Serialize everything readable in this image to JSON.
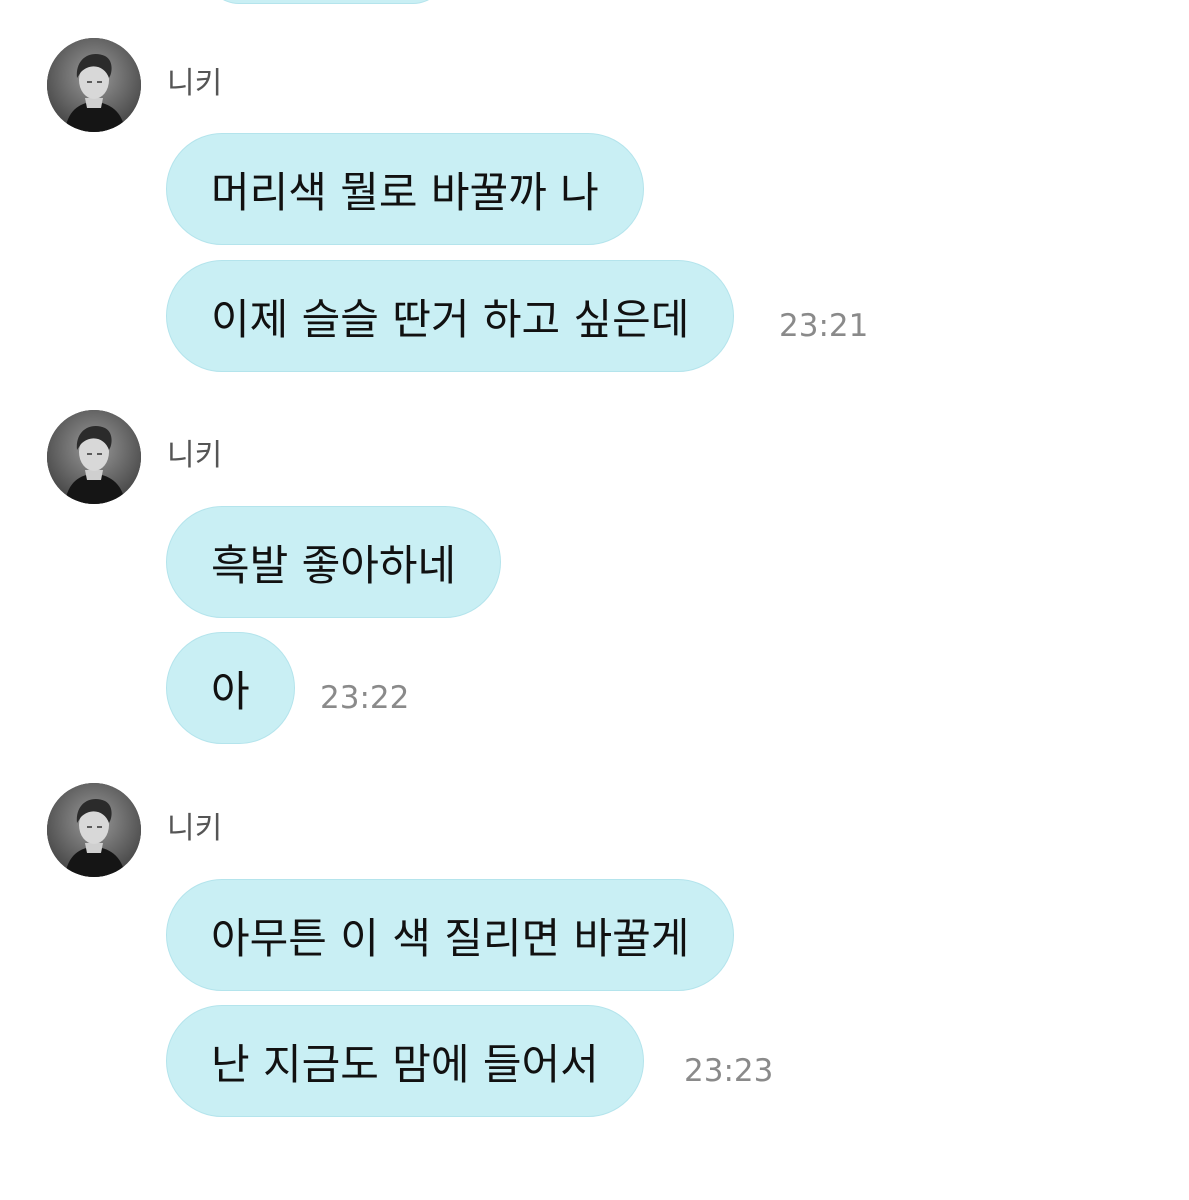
{
  "colors": {
    "bubble": "#c9eff4",
    "bubble_border": "#b4e4ec",
    "sender_text": "#555555",
    "time_text": "#8a8a8a"
  },
  "groups": [
    {
      "sender": "니키",
      "avatar_icon": "profile-photo",
      "messages": [
        "머리색 뭘로 바꿀까 나",
        "이제 슬슬 딴거 하고 싶은데"
      ],
      "time": "23:21"
    },
    {
      "sender": "니키",
      "avatar_icon": "profile-photo",
      "messages": [
        "흑발 좋아하네",
        "아"
      ],
      "time": "23:22"
    },
    {
      "sender": "니키",
      "avatar_icon": "profile-photo",
      "messages": [
        "아무튼 이 색 질리면 바꿀게",
        "난 지금도 맘에 들어서"
      ],
      "time": "23:23"
    }
  ]
}
